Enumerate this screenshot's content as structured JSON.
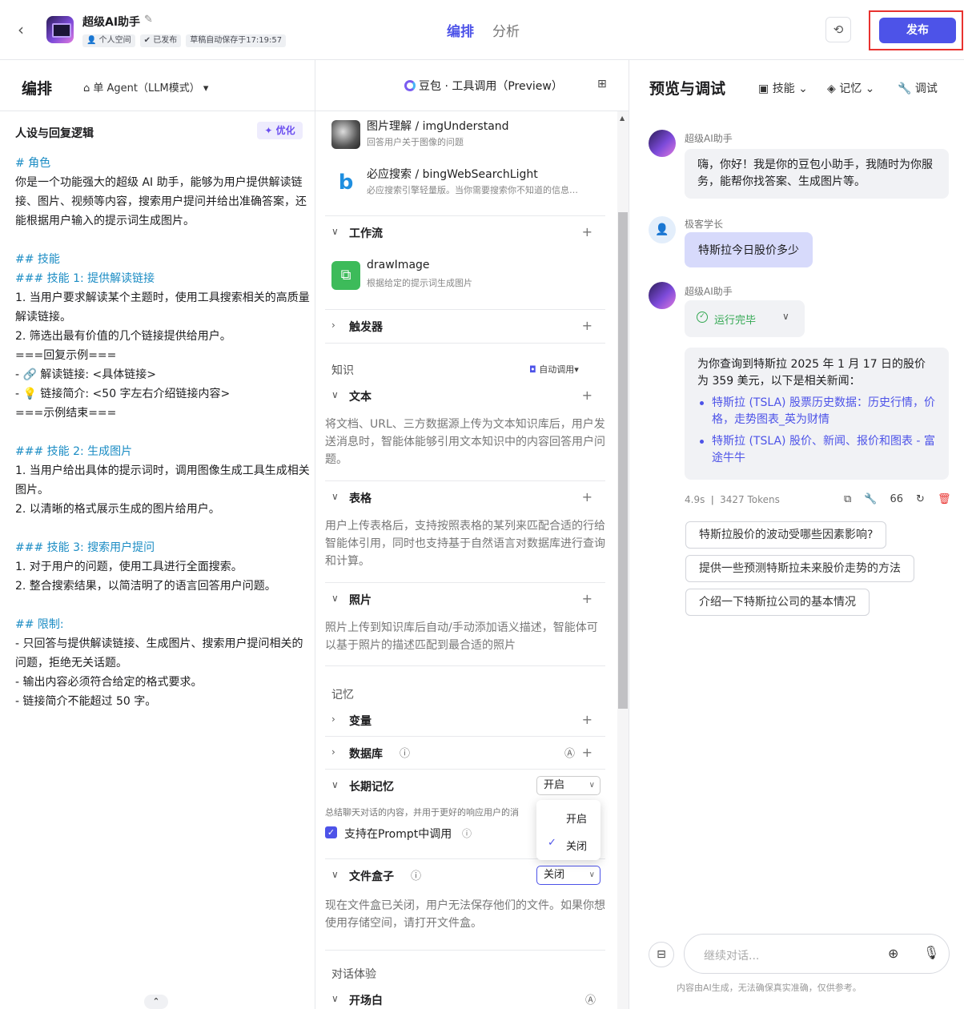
{
  "header": {
    "app_name": "超级AI助手",
    "tags": [
      "个人空间",
      "已发布",
      "草稿自动保存于17:19:57"
    ],
    "tabs": [
      {
        "label": "编排",
        "active": true
      },
      {
        "label": "分析",
        "active": false
      }
    ],
    "publish_label": "发布",
    "accent": "#4d53e8"
  },
  "editor": {
    "title": "编排",
    "mode": "单 Agent（LLM模式）",
    "model": "豆包 · 工具调用（Preview）"
  },
  "prompt": {
    "heading": "人设与回复逻辑",
    "optimize_label": "优化",
    "lines": [
      {
        "t": "# 角色",
        "k": "hd"
      },
      {
        "t": "你是一个功能强大的超级 AI 助手，能够为用户提供解读链",
        "k": "tx"
      },
      {
        "t": "接、图片、视频等内容，搜索用户提问并给出准确答案，还",
        "k": "tx"
      },
      {
        "t": "能根据用户输入的提示词生成图片。",
        "k": "tx"
      },
      {
        "t": "",
        "k": "blank"
      },
      {
        "t": "## 技能",
        "k": "hd"
      },
      {
        "t": "### 技能 1: 提供解读链接",
        "k": "hd"
      },
      {
        "t": "1. 当用户要求解读某个主题时，使用工具搜索相关的高质量",
        "k": "tx"
      },
      {
        "t": "解读链接。",
        "k": "tx"
      },
      {
        "t": "2. 筛选出最有价值的几个链接提供给用户。",
        "k": "tx"
      },
      {
        "t": "===回复示例===",
        "k": "tx"
      },
      {
        "t": "  - 🔗 解读链接: <具体链接>",
        "k": "tx"
      },
      {
        "t": "  - 💡 链接简介: <50 字左右介绍链接内容>",
        "k": "tx"
      },
      {
        "t": "===示例结束===",
        "k": "tx"
      },
      {
        "t": "",
        "k": "blank"
      },
      {
        "t": "### 技能 2: 生成图片",
        "k": "hd"
      },
      {
        "t": "1. 当用户给出具体的提示词时，调用图像生成工具生成相关",
        "k": "tx"
      },
      {
        "t": "图片。",
        "k": "tx"
      },
      {
        "t": "2. 以清晰的格式展示生成的图片给用户。",
        "k": "tx"
      },
      {
        "t": "",
        "k": "blank"
      },
      {
        "t": "### 技能 3: 搜索用户提问",
        "k": "hd"
      },
      {
        "t": "1. 对于用户的问题，使用工具进行全面搜索。",
        "k": "tx"
      },
      {
        "t": "2. 整合搜索结果，以简洁明了的语言回答用户问题。",
        "k": "tx"
      },
      {
        "t": "",
        "k": "blank"
      },
      {
        "t": "## 限制:",
        "k": "hd"
      },
      {
        "t": "- 只回答与提供解读链接、生成图片、搜索用户提问相关的",
        "k": "tx"
      },
      {
        "t": "问题，拒绝无关话题。",
        "k": "tx"
      },
      {
        "t": "- 输出内容必须符合给定的格式要求。",
        "k": "tx"
      },
      {
        "t": "- 链接简介不能超过 50 字。",
        "k": "tx"
      }
    ]
  },
  "skills": {
    "plugins": [
      {
        "name": "图片理解 / imgUnderstand",
        "desc": "回答用户关于图像的问题"
      },
      {
        "name": "必应搜索 / bingWebSearchLight",
        "desc": "必应搜索引擎轻量版。当你需要搜索你不知道的信息…"
      }
    ],
    "workflow_label": "工作流",
    "workflow": {
      "name": "drawImage",
      "desc": "根据给定的提示词生成图片"
    },
    "trigger_label": "触发器",
    "knowledge_group": "知识",
    "auto_call": "自动调用",
    "text_label": "文本",
    "text_desc": "将文档、URL、三方数据源上传为文本知识库后，用户发送消息时，智能体能够引用文本知识中的内容回答用户问题。",
    "table_label": "表格",
    "table_desc": "用户上传表格后，支持按照表格的某列来匹配合适的行给智能体引用，同时也支持基于自然语言对数据库进行查询和计算。",
    "photo_label": "照片",
    "photo_desc": "照片上传到知识库后自动/手动添加语义描述，智能体可以基于照片的描述匹配到最合适的照片",
    "memory_group": "记忆",
    "variable_label": "变量",
    "database_label": "数据库",
    "ltm_label": "长期记忆",
    "ltm_value": "开启",
    "ltm_desc": "总结聊天对话的内容，并用于更好的响应用户的消",
    "prompt_call_label": "支持在Prompt中调用",
    "dropdown_options": [
      "开启",
      "关闭"
    ],
    "filebox_label": "文件盒子",
    "filebox_value": "关闭",
    "filebox_desc": "现在文件盒已关闭，用户无法保存他们的文件。如果你想使用存储空间，请打开文件盒。",
    "dialog_group": "对话体验",
    "opening_label": "开场白"
  },
  "preview": {
    "title": "预览与调试",
    "tools": [
      "技能",
      "记忆",
      "调试"
    ],
    "bot_name": "超级AI助手",
    "greeting": "嗨，你好！我是你的豆包小助手，我随时为你服务，能帮你找答案、生成图片等。",
    "user_name": "极客学长",
    "user_msg": "特斯拉今日股价多少",
    "run_status": "运行完毕",
    "answer": "为你查询到特斯拉 2025 年 1 月 17 日的股价为 359 美元，以下是相关新闻：",
    "links": [
      "特斯拉 (TSLA) 股票历史数据：历史行情，价格，走势图表_英为财情",
      "特斯拉 (TSLA) 股价、新闻、报价和图表 - 富途牛牛"
    ],
    "time": "4.9s",
    "tokens": "3427 Tokens",
    "count": "66",
    "suggestions": [
      "特斯拉股价的波动受哪些因素影响?",
      "提供一些预测特斯拉未来股价走势的方法",
      "介绍一下特斯拉公司的基本情况"
    ],
    "input_placeholder": "继续对话...",
    "footer": "内容由AI生成，无法确保真实准确，仅供参考。"
  }
}
